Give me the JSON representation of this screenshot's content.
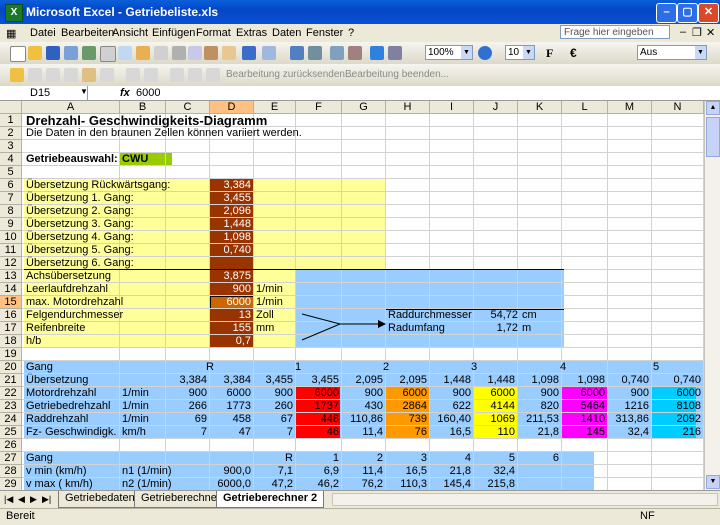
{
  "window": {
    "title": "Microsoft Excel - Getriebeliste.xls",
    "app_icon": "X"
  },
  "menu": {
    "items": [
      "Datei",
      "Bearbeiten",
      "Ansicht",
      "Einfügen",
      "Format",
      "Extras",
      "Daten",
      "Fenster",
      "?"
    ],
    "ask_placeholder": "Frage hier eingeben"
  },
  "toolbar": {
    "zoom": "100%",
    "font_size": "10",
    "bold": "F",
    "currency": "€",
    "font": "Aus"
  },
  "review_toolbar": {
    "reply_changes": "Bearbeitung zurücksenden...",
    "end_review": "Bearbeitung beenden..."
  },
  "formula_bar": {
    "name_box": "D15",
    "fx": "fx",
    "value": "6000"
  },
  "columns": [
    "A",
    "B",
    "C",
    "D",
    "E",
    "F",
    "G",
    "H",
    "I",
    "J",
    "K",
    "L",
    "M",
    "N"
  ],
  "rows": [
    "1",
    "2",
    "3",
    "4",
    "5",
    "6",
    "7",
    "8",
    "9",
    "10",
    "11",
    "12",
    "13",
    "14",
    "15",
    "16",
    "17",
    "18",
    "19",
    "20",
    "21",
    "22",
    "23",
    "24",
    "25",
    "26",
    "27",
    "28",
    "29"
  ],
  "sheet": {
    "title": "Drehzahl- Geschwindigkeits-Diagramm",
    "subtitle": "Die Daten in den braunen Zellen können variiert werden.",
    "gearbox_label": "Getriebeauswahl:",
    "gearbox_value": "CWU",
    "ratios": [
      {
        "label": "Übersetzung Rückwärtsgang:",
        "value": "3,384"
      },
      {
        "label": "Übersetzung 1. Gang:",
        "value": "3,455"
      },
      {
        "label": "Übersetzung 2. Gang:",
        "value": "2,096"
      },
      {
        "label": "Übersetzung 3. Gang:",
        "value": "1,448"
      },
      {
        "label": "Übersetzung 4. Gang:",
        "value": "1,098"
      },
      {
        "label": "Übersetzung 5. Gang:",
        "value": "0,740"
      },
      {
        "label": "Übersetzung 6. Gang:",
        "value": ""
      }
    ],
    "params": [
      {
        "label": "Achsübersetzung",
        "value": "3,875",
        "unit": ""
      },
      {
        "label": "Leerlaufdrehzahl",
        "value": "900",
        "unit": "1/min"
      },
      {
        "label": "max. Motordrehzahl",
        "value": "6000",
        "unit": "1/min"
      },
      {
        "label": "Felgendurchmesser",
        "value": "13",
        "unit": "Zoll"
      },
      {
        "label": "Reifenbreite",
        "value": "155",
        "unit": "mm"
      },
      {
        "label": "h/b",
        "value": "0,7",
        "unit": ""
      }
    ],
    "wheel": {
      "diameter_label": "Raddurchmesser",
      "diameter_value": "54,72",
      "diameter_unit": "cm",
      "circumference_label": "Radumfang",
      "circumference_value": "1,72",
      "circumference_unit": "m"
    },
    "table1": {
      "gang_label": "Gang",
      "gang_headers": [
        "R",
        "1",
        "2",
        "3",
        "4",
        "5"
      ],
      "rows": [
        {
          "label": "Übersetzung",
          "unit": "",
          "values": [
            "3,384",
            "3,384",
            "3,455",
            "3,455",
            "2,095",
            "2,095",
            "1,448",
            "1,448",
            "1,098",
            "1,098",
            "0,740",
            "0,740"
          ]
        },
        {
          "label": "Motordrehzahl",
          "unit": "1/min",
          "values": [
            "900",
            "6000",
            "900",
            "6000",
            "900",
            "6000",
            "900",
            "6000",
            "900",
            "6000",
            "900",
            "6000"
          ]
        },
        {
          "label": "Getriebedrehzahl",
          "unit": "1/min",
          "values": [
            "266",
            "1773",
            "260",
            "1737",
            "430",
            "2864",
            "622",
            "4144",
            "820",
            "5464",
            "1216",
            "8108"
          ]
        },
        {
          "label": "Raddrehzahl",
          "unit": "1/min",
          "values": [
            "69",
            "458",
            "67",
            "448",
            "110,86",
            "739",
            "160,40",
            "1069",
            "211,53",
            "1410",
            "313,86",
            "2092"
          ]
        },
        {
          "label": "Fz- Geschwindigk.",
          "unit": "km/h",
          "values": [
            "7",
            "47",
            "7",
            "46",
            "11,4",
            "76",
            "16,5",
            "110",
            "21,8",
            "145",
            "32,4",
            "216"
          ]
        }
      ]
    },
    "table2": {
      "gang_label": "Gang",
      "gang_headers": [
        "R",
        "1",
        "2",
        "3",
        "4",
        "5",
        "6"
      ],
      "rows": [
        {
          "label": "v min  (km/h)",
          "unit": "n1 (1/min)",
          "values": [
            "900,0",
            "7,1",
            "6,9",
            "11,4",
            "16,5",
            "21,8",
            "32,4"
          ]
        },
        {
          "label": "v max  ( km/h)",
          "unit": "n2 (1/min)",
          "values": [
            "6000,0",
            "47,2",
            "46,2",
            "76,2",
            "110,3",
            "145,4",
            "215,8"
          ]
        }
      ]
    }
  },
  "sheet_tabs": [
    "Getriebedaten",
    "Getrieberechner",
    "Getrieberechner 2"
  ],
  "status": {
    "left": "Bereit",
    "right": "NF"
  },
  "colors": {
    "brown": "#993300",
    "yellow": "#ffff99",
    "blue": "#99ccff",
    "green": "#99cc00",
    "red": "#ff0000",
    "orange": "#ff9900",
    "yellow_hi": "#ffff00",
    "magenta": "#ff00ff",
    "cyan": "#00ccff"
  }
}
